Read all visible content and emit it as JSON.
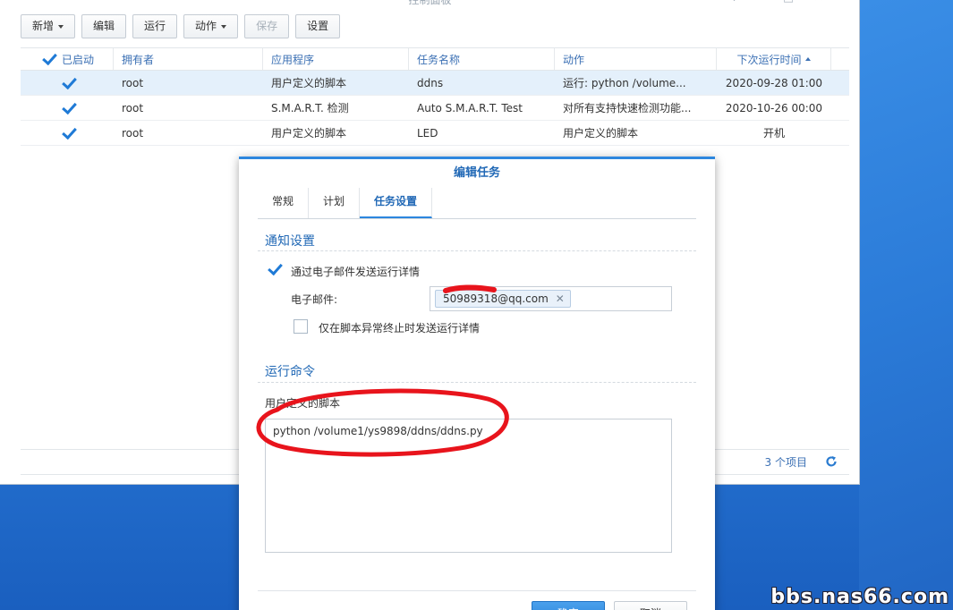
{
  "window": {
    "title": "控制面板"
  },
  "toolbar": {
    "create_label": "新增",
    "edit_label": "编辑",
    "run_label": "运行",
    "action_label": "动作",
    "save_label": "保存",
    "settings_label": "设置"
  },
  "table": {
    "headers": [
      "已启动",
      "拥有者",
      "应用程序",
      "任务名称",
      "动作",
      "下次运行时间"
    ],
    "rows": [
      {
        "enabled": true,
        "owner": "root",
        "application": "用户定义的脚本",
        "task": "ddns",
        "action": "运行: python /volume...",
        "next_run": "2020-09-28 01:00"
      },
      {
        "enabled": true,
        "owner": "root",
        "application": "S.M.A.R.T. 检测",
        "task": "Auto S.M.A.R.T. Test",
        "action": "对所有支持快速检测功能...",
        "next_run": "2020-10-26 00:00"
      },
      {
        "enabled": true,
        "owner": "root",
        "application": "用户定义的脚本",
        "task": "LED",
        "action": "用户定义的脚本",
        "next_run": "开机"
      }
    ],
    "item_count": "3 个项目"
  },
  "dialog": {
    "title": "编辑任务",
    "tabs": [
      "常规",
      "计划",
      "任务设置"
    ],
    "active_tab": "任务设置",
    "notify_section": "通知设置",
    "email_checkbox_label": "通过电子邮件发送运行详情",
    "email_checkbox_checked": true,
    "email_label": "电子邮件:",
    "email_value": "50989318@qq.com",
    "abnormal_checkbox_label": "仅在脚本异常终止时发送运行详情",
    "abnormal_checkbox_checked": false,
    "command_section": "运行命令",
    "script_label": "用户定义的脚本",
    "script_value": "python /volume1/ys9898/ddns/ddns.py",
    "ok_label": "确定",
    "cancel_label": "取消"
  },
  "watermark": "bbs.nas66.com",
  "colors": {
    "accent": "#2c86de",
    "link": "#3b70b4",
    "desktop": "#2470cf",
    "annotation": "#e8141c"
  }
}
